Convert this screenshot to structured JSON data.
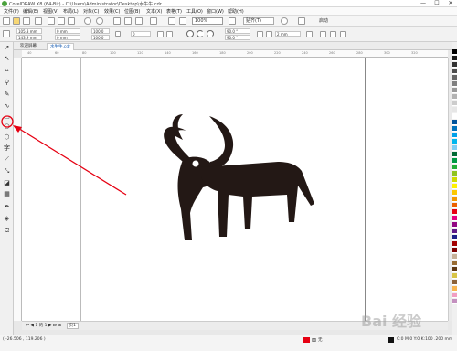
{
  "window": {
    "title": "CorelDRAW X8 (64-Bit) - C:\\Users\\Administrator\\Desktop\\水牛牛.cdr",
    "min_label": "—",
    "max_label": "☐",
    "close_label": "✕"
  },
  "menu": [
    "文件(F)",
    "编辑(E)",
    "视图(V)",
    "布局(L)",
    "对象(C)",
    "效果(C)",
    "位图(B)",
    "文本(X)",
    "表格(T)",
    "工具(O)",
    "窗口(W)",
    "帮助(H)"
  ],
  "toolbar": {
    "zoom": "100%",
    "snap": "贴齐(T)",
    "launch": "启动"
  },
  "propbar": {
    "x": "105.8 mm",
    "y": "143.9 mm",
    "w": "0 mm",
    "h": "0 mm",
    "sx": "100.0",
    "sy": "100.0",
    "angle": "0",
    "start_angle": "90.0 °",
    "end_angle": "90.0 °",
    "outline": "2 mm"
  },
  "tabs": [
    "欢迎屏幕",
    "水牛牛.cdr"
  ],
  "ruler_ticks": [
    "40",
    "60",
    "80",
    "100",
    "120",
    "140",
    "160",
    "180",
    "200",
    "220",
    "240",
    "260",
    "280",
    "300",
    "320"
  ],
  "page_nav": {
    "current": "1",
    "of_label": "的",
    "total": "1",
    "page_tab": "页1"
  },
  "status": {
    "coords": "( -26.506 , 119.206 )",
    "fill_label": "无",
    "outline_label": "C:0 M:0 Y:0 K:100  .200 mm"
  },
  "watermark": "Bai 经验",
  "palette": [
    "#000000",
    "#1a1a1a",
    "#333333",
    "#4d4d4d",
    "#666666",
    "#808080",
    "#999999",
    "#b3b3b3",
    "#cccccc",
    "#e6e6e6",
    "#ffffff",
    "#00539b",
    "#0072bc",
    "#00a0e9",
    "#00b7ee",
    "#7ecef4",
    "#006934",
    "#009944",
    "#22ac38",
    "#8fc31f",
    "#cfdb00",
    "#fff100",
    "#fcc800",
    "#f39800",
    "#eb6100",
    "#e60012",
    "#e4007f",
    "#920783",
    "#601986",
    "#1d2088",
    "#a40000",
    "#7f0000",
    "#c7b299",
    "#996c33",
    "#603813",
    "#d7c447",
    "#8c6239",
    "#f8b551",
    "#f19ec2",
    "#c490bf"
  ]
}
